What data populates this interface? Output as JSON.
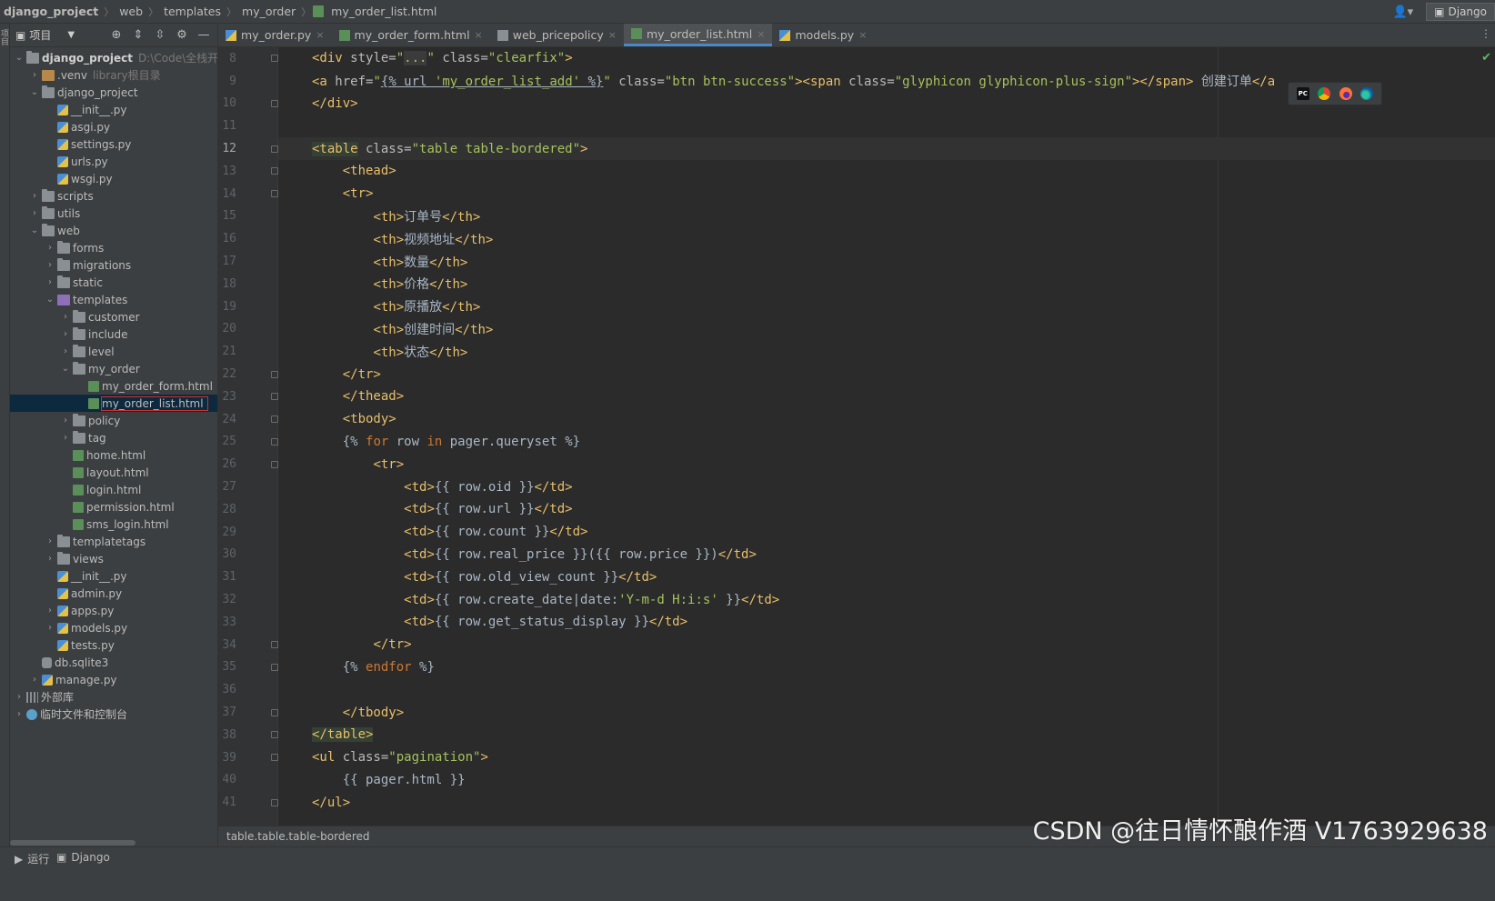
{
  "breadcrumb": [
    "django_project",
    "web",
    "templates",
    "my_order",
    "my_order_list.html"
  ],
  "run_config": "Django",
  "project_panel": {
    "title": "项目",
    "stripe_label": "项目",
    "tree": [
      {
        "depth": 0,
        "arrow": "down",
        "icon": "folder",
        "name": "django_project",
        "bold": true,
        "hint": "D:\\Code\\全栈开发"
      },
      {
        "depth": 1,
        "arrow": "right",
        "icon": "folder-venv",
        "name": ".venv",
        "hint": "library根目录"
      },
      {
        "depth": 1,
        "arrow": "down",
        "icon": "folder",
        "name": "django_project"
      },
      {
        "depth": 2,
        "arrow": "",
        "icon": "py",
        "name": "__init__.py"
      },
      {
        "depth": 2,
        "arrow": "",
        "icon": "py",
        "name": "asgi.py"
      },
      {
        "depth": 2,
        "arrow": "",
        "icon": "py",
        "name": "settings.py"
      },
      {
        "depth": 2,
        "arrow": "",
        "icon": "py",
        "name": "urls.py"
      },
      {
        "depth": 2,
        "arrow": "",
        "icon": "py",
        "name": "wsgi.py"
      },
      {
        "depth": 1,
        "arrow": "right",
        "icon": "folder",
        "name": "scripts"
      },
      {
        "depth": 1,
        "arrow": "right",
        "icon": "folder",
        "name": "utils"
      },
      {
        "depth": 1,
        "arrow": "down",
        "icon": "folder",
        "name": "web"
      },
      {
        "depth": 2,
        "arrow": "right",
        "icon": "folder",
        "name": "forms"
      },
      {
        "depth": 2,
        "arrow": "right",
        "icon": "folder",
        "name": "migrations"
      },
      {
        "depth": 2,
        "arrow": "right",
        "icon": "folder",
        "name": "static"
      },
      {
        "depth": 2,
        "arrow": "down",
        "icon": "folder-purple",
        "name": "templates"
      },
      {
        "depth": 3,
        "arrow": "right",
        "icon": "folder",
        "name": "customer"
      },
      {
        "depth": 3,
        "arrow": "right",
        "icon": "folder",
        "name": "include"
      },
      {
        "depth": 3,
        "arrow": "right",
        "icon": "folder",
        "name": "level"
      },
      {
        "depth": 3,
        "arrow": "down",
        "icon": "folder",
        "name": "my_order"
      },
      {
        "depth": 4,
        "arrow": "",
        "icon": "html",
        "name": "my_order_form.html"
      },
      {
        "depth": 4,
        "arrow": "",
        "icon": "html",
        "name": "my_order_list.html",
        "selected": true
      },
      {
        "depth": 3,
        "arrow": "right",
        "icon": "folder",
        "name": "policy"
      },
      {
        "depth": 3,
        "arrow": "right",
        "icon": "folder",
        "name": "tag"
      },
      {
        "depth": 3,
        "arrow": "",
        "icon": "html",
        "name": "home.html"
      },
      {
        "depth": 3,
        "arrow": "",
        "icon": "html",
        "name": "layout.html"
      },
      {
        "depth": 3,
        "arrow": "",
        "icon": "html",
        "name": "login.html"
      },
      {
        "depth": 3,
        "arrow": "",
        "icon": "html",
        "name": "permission.html"
      },
      {
        "depth": 3,
        "arrow": "",
        "icon": "html",
        "name": "sms_login.html"
      },
      {
        "depth": 2,
        "arrow": "right",
        "icon": "folder",
        "name": "templatetags"
      },
      {
        "depth": 2,
        "arrow": "right",
        "icon": "folder",
        "name": "views"
      },
      {
        "depth": 2,
        "arrow": "",
        "icon": "py",
        "name": "__init__.py"
      },
      {
        "depth": 2,
        "arrow": "",
        "icon": "py",
        "name": "admin.py"
      },
      {
        "depth": 2,
        "arrow": "right",
        "icon": "py",
        "name": "apps.py"
      },
      {
        "depth": 2,
        "arrow": "right",
        "icon": "py",
        "name": "models.py"
      },
      {
        "depth": 2,
        "arrow": "",
        "icon": "py",
        "name": "tests.py"
      },
      {
        "depth": 1,
        "arrow": "",
        "icon": "db",
        "name": "db.sqlite3"
      },
      {
        "depth": 1,
        "arrow": "right",
        "icon": "py",
        "name": "manage.py"
      },
      {
        "depth": 0,
        "arrow": "right",
        "icon": "lib",
        "name": "外部库"
      },
      {
        "depth": 0,
        "arrow": "right",
        "icon": "scratch",
        "name": "临时文件和控制台"
      }
    ]
  },
  "tabs": [
    {
      "label": "my_order.py",
      "icon": "py",
      "active": false
    },
    {
      "label": "my_order_form.html",
      "icon": "html",
      "active": false
    },
    {
      "label": "web_pricepolicy",
      "icon": "table",
      "active": false
    },
    {
      "label": "my_order_list.html",
      "icon": "html",
      "active": true
    },
    {
      "label": "models.py",
      "icon": "py",
      "active": false
    }
  ],
  "code_lines": [
    {
      "n": "8",
      "fold": true,
      "html": "<span class=\"tg\">&lt;div </span><span class=\"at\">style=</span><span class=\"st\">\"<span class=\"dots\">...</span>\"</span><span class=\"at\"> class=</span><span class=\"st\">\"clearfix\"</span><span class=\"tg\">&gt;</span>"
    },
    {
      "n": "9",
      "fold": false,
      "html": "<span class=\"tg\">&lt;a </span><span class=\"at\">href=</span><span class=\"st\">\"<span class=\"fn\">{% url <span class=\"st\">'my_order_list_add'</span> %}</span>\"</span><span class=\"at\"> class=</span><span class=\"st\">\"btn btn-success\"</span><span class=\"tg\">&gt;&lt;span </span><span class=\"at\">class=</span><span class=\"st\">\"glyphicon glyphicon-plus-sign\"</span><span class=\"tg\">&gt;&lt;/span&gt;</span><span class=\"tx\"> 创建订单</span><span class=\"tg\">&lt;/a</span>"
    },
    {
      "n": "10",
      "fold": true,
      "html": "<span class=\"tg\">&lt;/div&gt;</span>"
    },
    {
      "n": "11",
      "fold": false,
      "html": ""
    },
    {
      "n": "12",
      "fold": true,
      "current": true,
      "html": "<span class=\"tg hl\">&lt;table</span><span class=\"at\"> class=</span><span class=\"st\">\"table table-bordered\"</span><span class=\"tg\">&gt;</span>"
    },
    {
      "n": "13",
      "fold": true,
      "html": "    <span class=\"tg\">&lt;thead&gt;</span>"
    },
    {
      "n": "14",
      "fold": true,
      "html": "    <span class=\"tg\">&lt;tr&gt;</span>"
    },
    {
      "n": "15",
      "fold": false,
      "html": "        <span class=\"tg\">&lt;th&gt;</span><span class=\"tx\">订单号</span><span class=\"tg\">&lt;/th&gt;</span>"
    },
    {
      "n": "16",
      "fold": false,
      "html": "        <span class=\"tg\">&lt;th&gt;</span><span class=\"tx\">视频地址</span><span class=\"tg\">&lt;/th&gt;</span>"
    },
    {
      "n": "17",
      "fold": false,
      "html": "        <span class=\"tg\">&lt;th&gt;</span><span class=\"tx\">数量</span><span class=\"tg\">&lt;/th&gt;</span>"
    },
    {
      "n": "18",
      "fold": false,
      "html": "        <span class=\"tg\">&lt;th&gt;</span><span class=\"tx\">价格</span><span class=\"tg\">&lt;/th&gt;</span>"
    },
    {
      "n": "19",
      "fold": false,
      "html": "        <span class=\"tg\">&lt;th&gt;</span><span class=\"tx\">原播放</span><span class=\"tg\">&lt;/th&gt;</span>"
    },
    {
      "n": "20",
      "fold": false,
      "html": "        <span class=\"tg\">&lt;th&gt;</span><span class=\"tx\">创建时间</span><span class=\"tg\">&lt;/th&gt;</span>"
    },
    {
      "n": "21",
      "fold": false,
      "html": "        <span class=\"tg\">&lt;th&gt;</span><span class=\"tx\">状态</span><span class=\"tg\">&lt;/th&gt;</span>"
    },
    {
      "n": "22",
      "fold": true,
      "html": "    <span class=\"tg\">&lt;/tr&gt;</span>"
    },
    {
      "n": "23",
      "fold": true,
      "html": "    <span class=\"tg\">&lt;/thead&gt;</span>"
    },
    {
      "n": "24",
      "fold": true,
      "html": "    <span class=\"tg\">&lt;tbody&gt;</span>"
    },
    {
      "n": "25",
      "fold": true,
      "html": "    <span class=\"tx\">{% </span><span class=\"kw\">for</span><span class=\"tx\"> row </span><span class=\"kw\">in</span><span class=\"tx\"> pager.queryset %}</span>"
    },
    {
      "n": "26",
      "fold": true,
      "html": "        <span class=\"tg\">&lt;tr&gt;</span>"
    },
    {
      "n": "27",
      "fold": false,
      "html": "            <span class=\"tg\">&lt;td&gt;</span><span class=\"tx\">{{ row.oid }}</span><span class=\"tg\">&lt;/td&gt;</span>"
    },
    {
      "n": "28",
      "fold": false,
      "html": "            <span class=\"tg\">&lt;td&gt;</span><span class=\"tx\">{{ row.url }}</span><span class=\"tg\">&lt;/td&gt;</span>"
    },
    {
      "n": "29",
      "fold": false,
      "html": "            <span class=\"tg\">&lt;td&gt;</span><span class=\"tx\">{{ row.count }}</span><span class=\"tg\">&lt;/td&gt;</span>"
    },
    {
      "n": "30",
      "fold": false,
      "html": "            <span class=\"tg\">&lt;td&gt;</span><span class=\"tx\">{{ row.real_price }}({{ row.price }})</span><span class=\"tg\">&lt;/td&gt;</span>"
    },
    {
      "n": "31",
      "fold": false,
      "html": "            <span class=\"tg\">&lt;td&gt;</span><span class=\"tx\">{{ row.old_view_count }}</span><span class=\"tg\">&lt;/td&gt;</span>"
    },
    {
      "n": "32",
      "fold": false,
      "html": "            <span class=\"tg\">&lt;td&gt;</span><span class=\"tx\">{{ row.create_date|date:</span><span class=\"st\">'Y-m-d H:i:s'</span><span class=\"tx\"> }}</span><span class=\"tg\">&lt;/td&gt;</span>"
    },
    {
      "n": "33",
      "fold": false,
      "html": "            <span class=\"tg\">&lt;td&gt;</span><span class=\"tx\">{{ row.get_status_display }}</span><span class=\"tg\">&lt;/td&gt;</span>"
    },
    {
      "n": "34",
      "fold": true,
      "html": "        <span class=\"tg\">&lt;/tr&gt;</span>"
    },
    {
      "n": "35",
      "fold": true,
      "html": "    <span class=\"tx\">{% </span><span class=\"kw\">endfor</span><span class=\"tx\"> %}</span>"
    },
    {
      "n": "36",
      "fold": false,
      "html": ""
    },
    {
      "n": "37",
      "fold": true,
      "html": "    <span class=\"tg\">&lt;/tbody&gt;</span>"
    },
    {
      "n": "38",
      "fold": true,
      "html": "<span class=\"tg hl\">&lt;/table&gt;</span>"
    },
    {
      "n": "39",
      "fold": true,
      "html": "<span class=\"tg\">&lt;ul </span><span class=\"at\">class=</span><span class=\"st\">\"pagination\"</span><span class=\"tg\">&gt;</span>"
    },
    {
      "n": "40",
      "fold": false,
      "html": "    <span class=\"tx\">{{ pager.html }}</span>"
    },
    {
      "n": "41",
      "fold": true,
      "html": "<span class=\"tg\">&lt;/ul&gt;</span>"
    }
  ],
  "editor_status_path": "table.table.table-bordered",
  "bottom_tabs": [
    "运行",
    "Django"
  ],
  "watermark": "CSDN @往日情怀酿作酒 V1763929638",
  "colors": {
    "accent": "#4a88c7",
    "tag": "#e8bf6a",
    "string": "#a5c25c",
    "keyword": "#cc7832"
  }
}
